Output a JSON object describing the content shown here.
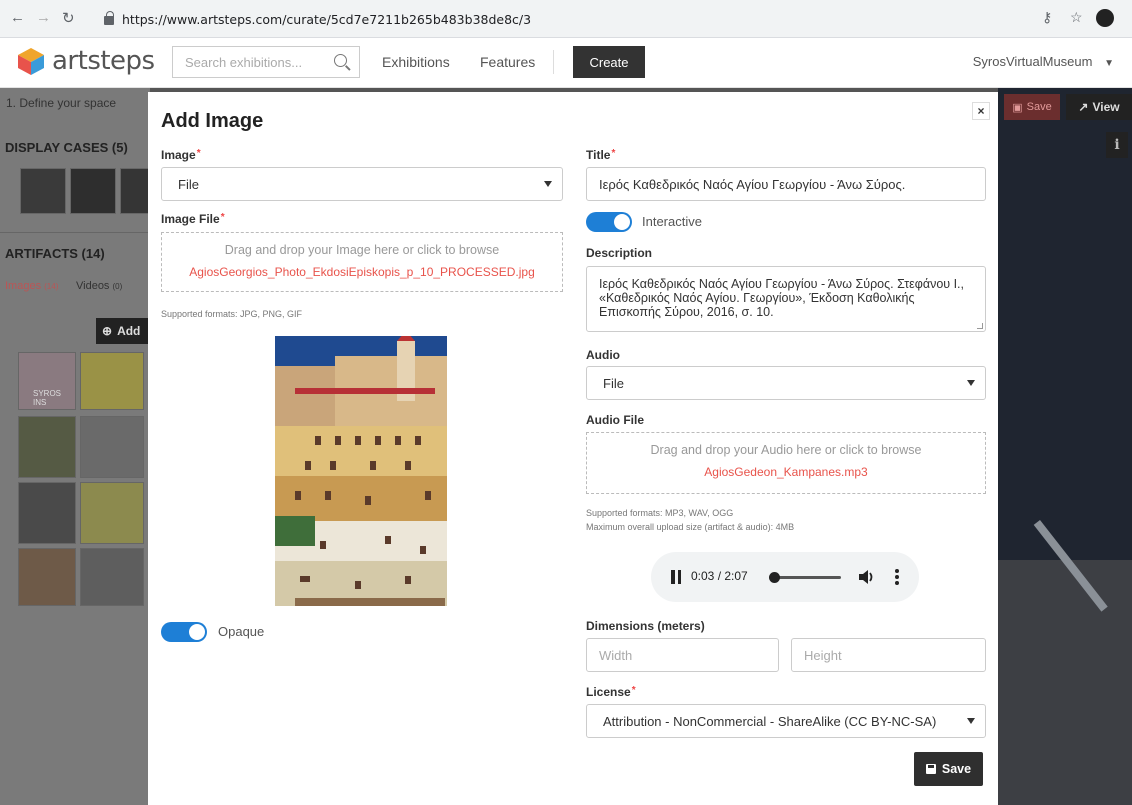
{
  "browser": {
    "url": "https://www.artsteps.com/curate/5cd7e7211b265b483b38de8c/3"
  },
  "header": {
    "logo_text": "artsteps",
    "search_placeholder": "Search exhibitions...",
    "nav": [
      "Exhibitions",
      "Features"
    ],
    "create_label": "Create",
    "user_name": "SyrosVirtualMuseum"
  },
  "background": {
    "step_label": "1. Define your space",
    "display_cases_title": "DISPLAY CASES (5)",
    "artifacts_title": "ARTIFACTS (14)",
    "tab_images": "Images",
    "tab_images_count": "(14)",
    "tab_videos": "Videos",
    "tab_videos_count": "(0)",
    "add_label": "Add",
    "save_label": "Save",
    "view_label": "View",
    "info_label": "i",
    "thumb_syros": "SYROS INS"
  },
  "modal": {
    "title": "Add Image",
    "close_label": "×",
    "image_label": "Image",
    "image_select_value": "File",
    "image_file_label": "Image File",
    "image_drop_hint": "Drag and drop your Image here or click to browse",
    "image_file_name": "AgiosGeorgios_Photo_EkdosiEpiskopis_p_10_PROCESSED.jpg",
    "image_formats": "Supported formats: JPG, PNG, GIF",
    "opaque_label": "Opaque",
    "opaque_on": true,
    "title_label": "Title",
    "title_value": "Ιερός Καθεδρικός Ναός Αγίου Γεωργίου - Άνω Σύρος.",
    "interactive_label": "Interactive",
    "interactive_on": true,
    "description_label": "Description",
    "description_value": "Ιερός Καθεδρικός Ναός Αγίου Γεωργίου - Άνω Σύρος. Στεφάνου Ι., «Καθεδρικός Ναός Αγίου. Γεωργίου», Έκδοση Καθολικής Επισκοπής Σύρου, 2016, σ. 10.",
    "audio_label": "Audio",
    "audio_select_value": "File",
    "audio_file_label": "Audio File",
    "audio_drop_hint": "Drag and drop your Audio here or click to browse",
    "audio_file_name": "AgiosGedeon_Kampanes.mp3",
    "audio_formats": "Supported formats: MP3, WAV, OGG",
    "audio_max_size": "Maximum overall upload size (artifact & audio): 4MB",
    "player_time": "0:03 / 2:07",
    "dimensions_label": "Dimensions (meters)",
    "width_placeholder": "Width",
    "height_placeholder": "Height",
    "license_label": "License",
    "license_value": "Attribution - NonCommercial - ShareAlike (CC BY-NC-SA)",
    "save_label": "Save",
    "required_mark": "*"
  },
  "colors": {
    "accent_blue": "#1e7fd6",
    "file_link_red": "#e8534b",
    "dark_button": "#2f2f2f"
  }
}
